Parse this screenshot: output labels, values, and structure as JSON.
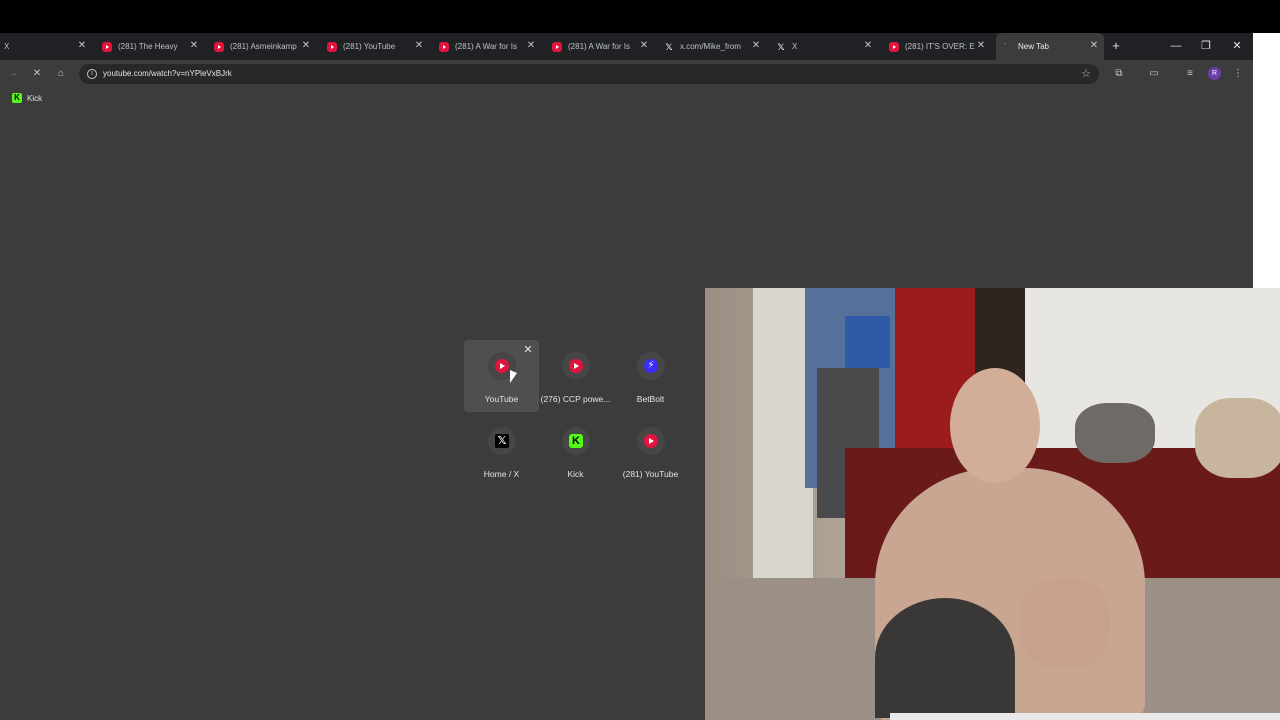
{
  "tabs": [
    {
      "title": "X",
      "favicon": "x-icon"
    },
    {
      "title": "(281) The Heavy",
      "favicon": "youtube-icon"
    },
    {
      "title": "(281) Asmeinkamp",
      "favicon": "youtube-icon"
    },
    {
      "title": "(281) YouTube",
      "favicon": "youtube-icon"
    },
    {
      "title": "(281) A War for Is",
      "favicon": "youtube-icon"
    },
    {
      "title": "(281) A War for Is",
      "favicon": "youtube-icon"
    },
    {
      "title": "x.com/Mike_from",
      "favicon": "x-icon"
    },
    {
      "title": "X",
      "favicon": "x-icon"
    },
    {
      "title": "(281) IT'S OVER: E",
      "favicon": "youtube-icon"
    },
    {
      "title": "New Tab",
      "favicon": "loading-icon",
      "active": true
    }
  ],
  "toolbar": {
    "url": "youtube.com/watch?v=nYPleVxBJrk",
    "profile_initial": "R"
  },
  "bookmarks": [
    {
      "label": "Kick"
    }
  ],
  "shortcuts": [
    {
      "label": "YouTube",
      "icon": "youtube-icon"
    },
    {
      "label": "(276) CCP powe...",
      "icon": "youtube-icon"
    },
    {
      "label": "BetBolt",
      "icon": "bolt-icon"
    },
    {
      "label": "Home / X",
      "icon": "x-icon"
    },
    {
      "label": "Kick",
      "icon": "kick-icon"
    },
    {
      "label": "(281) YouTube",
      "icon": "youtube-icon"
    }
  ],
  "colors": {
    "accent_youtube": "#e0143c",
    "accent_kick": "#53fc18",
    "page_background": "#3c3c3c"
  }
}
